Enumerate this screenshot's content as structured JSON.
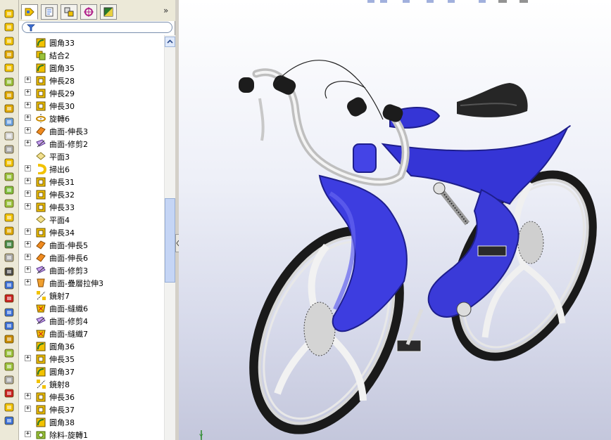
{
  "feature_manager": {
    "tabs": [
      {
        "icon": "feature-tree-icon",
        "active": true
      },
      {
        "icon": "property-manager-icon",
        "active": false
      },
      {
        "icon": "configuration-manager-icon",
        "active": false
      },
      {
        "icon": "dimxpert-icon",
        "active": false
      },
      {
        "icon": "display-manager-icon",
        "active": false
      }
    ],
    "more_glyph": "»",
    "filter_icon": "filter-icon",
    "tree": [
      {
        "label": "圓角33",
        "expand": false,
        "icon": "fillet"
      },
      {
        "label": "結合2",
        "expand": false,
        "icon": "combine"
      },
      {
        "label": "圓角35",
        "expand": false,
        "icon": "fillet"
      },
      {
        "label": "伸長28",
        "expand": true,
        "icon": "extrude"
      },
      {
        "label": "伸長29",
        "expand": true,
        "icon": "extrude"
      },
      {
        "label": "伸長30",
        "expand": true,
        "icon": "extrude"
      },
      {
        "label": "旋轉6",
        "expand": true,
        "icon": "revolve"
      },
      {
        "label": "曲面-伸長3",
        "expand": true,
        "icon": "surface-extrude"
      },
      {
        "label": "曲面-修剪2",
        "expand": true,
        "icon": "surface-trim"
      },
      {
        "label": "平面3",
        "expand": false,
        "icon": "plane"
      },
      {
        "label": "掃出6",
        "expand": true,
        "icon": "sweep"
      },
      {
        "label": "伸長31",
        "expand": true,
        "icon": "extrude"
      },
      {
        "label": "伸長32",
        "expand": true,
        "icon": "extrude"
      },
      {
        "label": "伸長33",
        "expand": true,
        "icon": "extrude"
      },
      {
        "label": "平面4",
        "expand": false,
        "icon": "plane"
      },
      {
        "label": "伸長34",
        "expand": true,
        "icon": "extrude"
      },
      {
        "label": "曲面-伸長5",
        "expand": true,
        "icon": "surface-extrude"
      },
      {
        "label": "曲面-伸長6",
        "expand": true,
        "icon": "surface-extrude"
      },
      {
        "label": "曲面-修剪3",
        "expand": true,
        "icon": "surface-trim"
      },
      {
        "label": "曲面-疊層拉伸3",
        "expand": true,
        "icon": "surface-loft"
      },
      {
        "label": "鏡射7",
        "expand": false,
        "icon": "mirror"
      },
      {
        "label": "曲面-縫織6",
        "expand": false,
        "icon": "knit"
      },
      {
        "label": "曲面-修剪4",
        "expand": false,
        "icon": "surface-trim"
      },
      {
        "label": "曲面-縫織7",
        "expand": false,
        "icon": "knit"
      },
      {
        "label": "圓角36",
        "expand": false,
        "icon": "fillet"
      },
      {
        "label": "伸長35",
        "expand": true,
        "icon": "extrude"
      },
      {
        "label": "圓角37",
        "expand": false,
        "icon": "fillet"
      },
      {
        "label": "鏡射8",
        "expand": false,
        "icon": "mirror"
      },
      {
        "label": "伸長36",
        "expand": true,
        "icon": "extrude"
      },
      {
        "label": "伸長37",
        "expand": true,
        "icon": "extrude"
      },
      {
        "label": "圓角38",
        "expand": false,
        "icon": "fillet"
      },
      {
        "label": "除料-旋轉1",
        "expand": true,
        "icon": "cut-revolve"
      }
    ]
  },
  "command_toolbar": [
    "extrude-boss-icon",
    "revolve-boss-icon",
    "sweep-icon",
    "loft-icon",
    "cut-extrude-icon",
    "hole-icon",
    "fillet-icon",
    "chamfer-icon",
    "rib-icon",
    "shell-icon",
    "draft-icon",
    "dome-icon",
    "linear-pattern-icon",
    "mirror-icon",
    "plane-icon",
    "axis-icon",
    "curve-icon",
    "sketch-icon",
    "smart-dimension-icon",
    "line-icon",
    "rectangle-icon",
    "circle-icon",
    "arc-icon",
    "spline-icon",
    "trim-icon",
    "convert-icon",
    "offset-icon",
    "pattern-icon",
    "relations-icon",
    "repair-icon",
    "view-icon",
    "measure-icon"
  ],
  "viewport": {
    "model": "bicycle-3d-model",
    "colors": {
      "frame": "#3535d6",
      "frame_dark": "#1e1e8c",
      "chrome": "#dcdcdc",
      "tire": "#1a1a1a",
      "seat": "#262626"
    },
    "triad_label": "Y"
  }
}
